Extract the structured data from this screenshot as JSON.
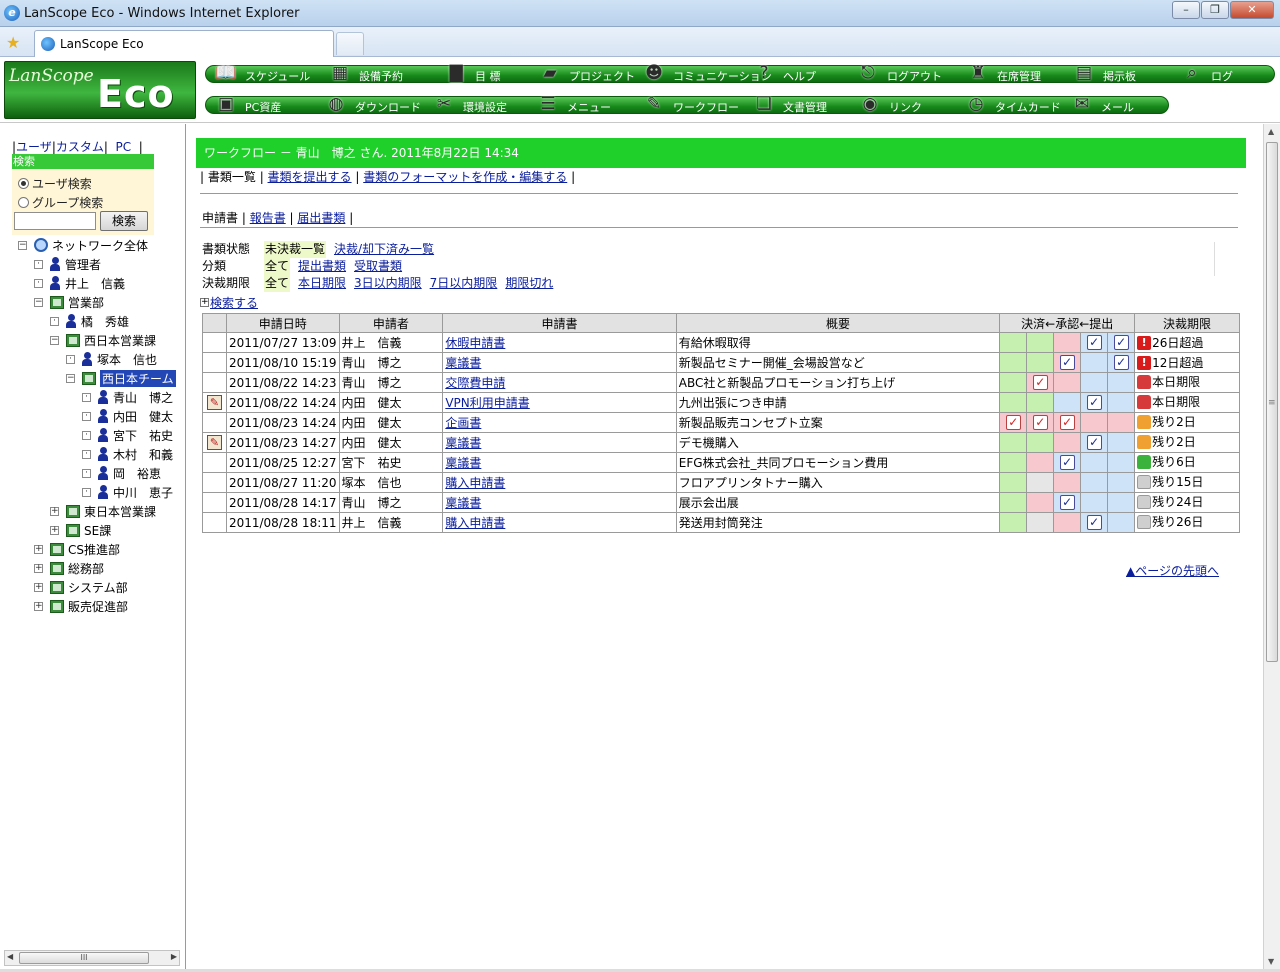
{
  "window": {
    "title": "LanScope Eco - Windows Internet Explorer",
    "tab_title": "LanScope Eco"
  },
  "logo": {
    "line1": "LanScope",
    "line2": "Eco"
  },
  "nav_row1": [
    {
      "label": "スケジュール",
      "icon": "notebook-icon"
    },
    {
      "label": "設備予約",
      "icon": "calculator-icon"
    },
    {
      "label": "目 標",
      "icon": "bar-chart-icon"
    },
    {
      "label": "プロジェクト",
      "icon": "folder-icon"
    },
    {
      "label": "コミュニケーション",
      "icon": "people-icon"
    },
    {
      "label": "ヘルプ",
      "icon": "question-icon"
    },
    {
      "label": "ログアウト",
      "icon": "exit-sign-icon"
    },
    {
      "label": "在席管理",
      "icon": "person-stool-icon"
    },
    {
      "label": "掲示板",
      "icon": "board-icon"
    },
    {
      "label": "ログ",
      "icon": "magnifier-icon"
    }
  ],
  "nav_row2": [
    {
      "label": "PC資産",
      "icon": "computer-icon"
    },
    {
      "label": "ダウンロード",
      "icon": "globe-download-icon"
    },
    {
      "label": "環境設定",
      "icon": "tools-icon"
    },
    {
      "label": "メニュー",
      "icon": "menu-icon"
    },
    {
      "label": "ワークフロー",
      "icon": "workflow-icon"
    },
    {
      "label": "文書管理",
      "icon": "document-stack-icon"
    },
    {
      "label": "リンク",
      "icon": "link-globe-icon"
    },
    {
      "label": "タイムカード",
      "icon": "time-card-icon"
    },
    {
      "label": "メール",
      "icon": "mail-icon"
    }
  ],
  "left": {
    "tabs": [
      "ユーザ",
      "カスタム",
      "PC"
    ],
    "search_header": "検索",
    "radio_user": "ユーザ検索",
    "radio_group": "グループ検索",
    "search_button": "検索",
    "search_value": "",
    "tree": [
      {
        "label": "ネットワーク全体",
        "type": "network",
        "toggle": "−"
      },
      {
        "label": "管理者",
        "type": "person",
        "toggle": "·"
      },
      {
        "label": "井上　信義",
        "type": "person",
        "toggle": "·"
      },
      {
        "label": "営業部",
        "type": "group",
        "toggle": "−"
      },
      {
        "label": "橘　秀雄",
        "type": "person",
        "toggle": "·"
      },
      {
        "label": "西日本営業課",
        "type": "group",
        "toggle": "−"
      },
      {
        "label": "塚本　信也",
        "type": "person",
        "toggle": "·"
      },
      {
        "label": "西日本チーム",
        "type": "group",
        "toggle": "−",
        "selected": true
      },
      {
        "label": "青山　博之",
        "type": "person",
        "toggle": "·"
      },
      {
        "label": "内田　健太",
        "type": "person",
        "toggle": "·"
      },
      {
        "label": "宮下　祐史",
        "type": "person",
        "toggle": "·"
      },
      {
        "label": "木村　和義",
        "type": "person",
        "toggle": "·"
      },
      {
        "label": "岡　裕恵",
        "type": "person",
        "toggle": "·"
      },
      {
        "label": "中川　恵子",
        "type": "person",
        "toggle": "·"
      },
      {
        "label": "東日本営業課",
        "type": "group",
        "toggle": "+"
      },
      {
        "label": "SE課",
        "type": "group",
        "toggle": "+"
      },
      {
        "label": "CS推進部",
        "type": "group",
        "toggle": "+"
      },
      {
        "label": "総務部",
        "type": "group",
        "toggle": "+"
      },
      {
        "label": "システム部",
        "type": "group",
        "toggle": "+"
      },
      {
        "label": "販売促進部",
        "type": "group",
        "toggle": "+"
      }
    ],
    "scroll_grip": "III"
  },
  "main": {
    "header": "ワークフロー － 青山　博之 さん. 2011年8月22日 14:34",
    "subnav": [
      "書類一覧",
      "書類を提出する",
      "書類のフォーマットを作成・編集する"
    ],
    "doc_tabs": [
      "申請書",
      "報告書",
      "届出書類"
    ],
    "filters": {
      "status_label": "書類状態",
      "status_current": "未決裁一覧",
      "status_other": "決裁/却下済み一覧",
      "class_label": "分類",
      "class_current": "全て",
      "class_options": [
        "提出書類",
        "受取書類"
      ],
      "deadline_label": "決裁期限",
      "deadline_current": "全て",
      "deadline_options": [
        "本日期限",
        "3日以内期限",
        "7日以内期限",
        "期限切れ"
      ]
    },
    "search_toggle": "検索する",
    "columns": [
      "申請日時",
      "申請者",
      "申請書",
      "概要",
      "決済←承認←提出",
      "決裁期限"
    ],
    "rows": [
      {
        "mark": "",
        "date": "2011/07/27 13:09",
        "applicant": "井上　信義",
        "doc": "休暇申請書",
        "summary": "有給休暇取得",
        "stages": [
          "g",
          "g",
          "p",
          "b:x",
          "b:x"
        ],
        "status_icon": "red",
        "status_glyph": "!",
        "status": "26日超過"
      },
      {
        "mark": "",
        "date": "2011/08/10 15:19",
        "applicant": "青山　博之",
        "doc": "稟議書",
        "summary": "新製品セミナー開催_会場設営など",
        "stages": [
          "g",
          "g",
          "p:x",
          "b",
          "b:x"
        ],
        "status_icon": "red",
        "status_glyph": "!",
        "status": "12日超過"
      },
      {
        "mark": "",
        "date": "2011/08/22 14:23",
        "applicant": "青山　博之",
        "doc": "交際費申請",
        "summary": "ABC社と新製品プロモーション打ち上げ",
        "stages": [
          "g",
          "p:rx",
          "p",
          "b",
          "b"
        ],
        "status_icon": "rbag",
        "status_glyph": "",
        "status": "本日期限"
      },
      {
        "mark": "pen",
        "date": "2011/08/22 14:24",
        "applicant": "内田　健太",
        "doc": "VPN利用申請書",
        "summary": "九州出張につき申請",
        "stages": [
          "g",
          "g",
          "b",
          "b:x",
          "b"
        ],
        "status_icon": "rbag",
        "status_glyph": "",
        "status": "本日期限"
      },
      {
        "mark": "",
        "date": "2011/08/23 14:24",
        "applicant": "内田　健太",
        "doc": "企画書",
        "summary": "新製品販売コンセプト立案",
        "stages": [
          "p:rx",
          "p:rx",
          "p:rx",
          "p",
          "p"
        ],
        "status_icon": "obag",
        "status_glyph": "",
        "status": "残り2日"
      },
      {
        "mark": "pen",
        "date": "2011/08/23 14:27",
        "applicant": "内田　健太",
        "doc": "稟議書",
        "summary": "デモ機購入",
        "stages": [
          "g",
          "g",
          "p",
          "b:x",
          "b"
        ],
        "status_icon": "obag",
        "status_glyph": "",
        "status": "残り2日"
      },
      {
        "mark": "",
        "date": "2011/08/25 12:27",
        "applicant": "宮下　祐史",
        "doc": "稟議書",
        "summary": "EFG株式会社_共同プロモーション費用",
        "stages": [
          "g",
          "p",
          "b:x",
          "b",
          "b"
        ],
        "status_icon": "gbag",
        "status_glyph": "",
        "status": "残り6日"
      },
      {
        "mark": "",
        "date": "2011/08/27 11:20",
        "applicant": "塚本　信也",
        "doc": "購入申請書",
        "summary": "フロアプリンタトナー購入",
        "stages": [
          "g",
          "gr",
          "p",
          "b",
          "b"
        ],
        "status_icon": "wbag",
        "status_glyph": "",
        "status": "残り15日"
      },
      {
        "mark": "",
        "date": "2011/08/28 14:17",
        "applicant": "青山　博之",
        "doc": "稟議書",
        "summary": "展示会出展",
        "stages": [
          "g",
          "p",
          "b:x",
          "b",
          "b"
        ],
        "status_icon": "wbag",
        "status_glyph": "",
        "status": "残り24日"
      },
      {
        "mark": "",
        "date": "2011/08/28 18:11",
        "applicant": "井上　信義",
        "doc": "購入申請書",
        "summary": "発送用封筒発注",
        "stages": [
          "g",
          "gr",
          "p",
          "b:x",
          "b"
        ],
        "status_icon": "wbag",
        "status_glyph": "",
        "status": "残り26日"
      }
    ],
    "top_link": "▲ページの先頭へ"
  }
}
